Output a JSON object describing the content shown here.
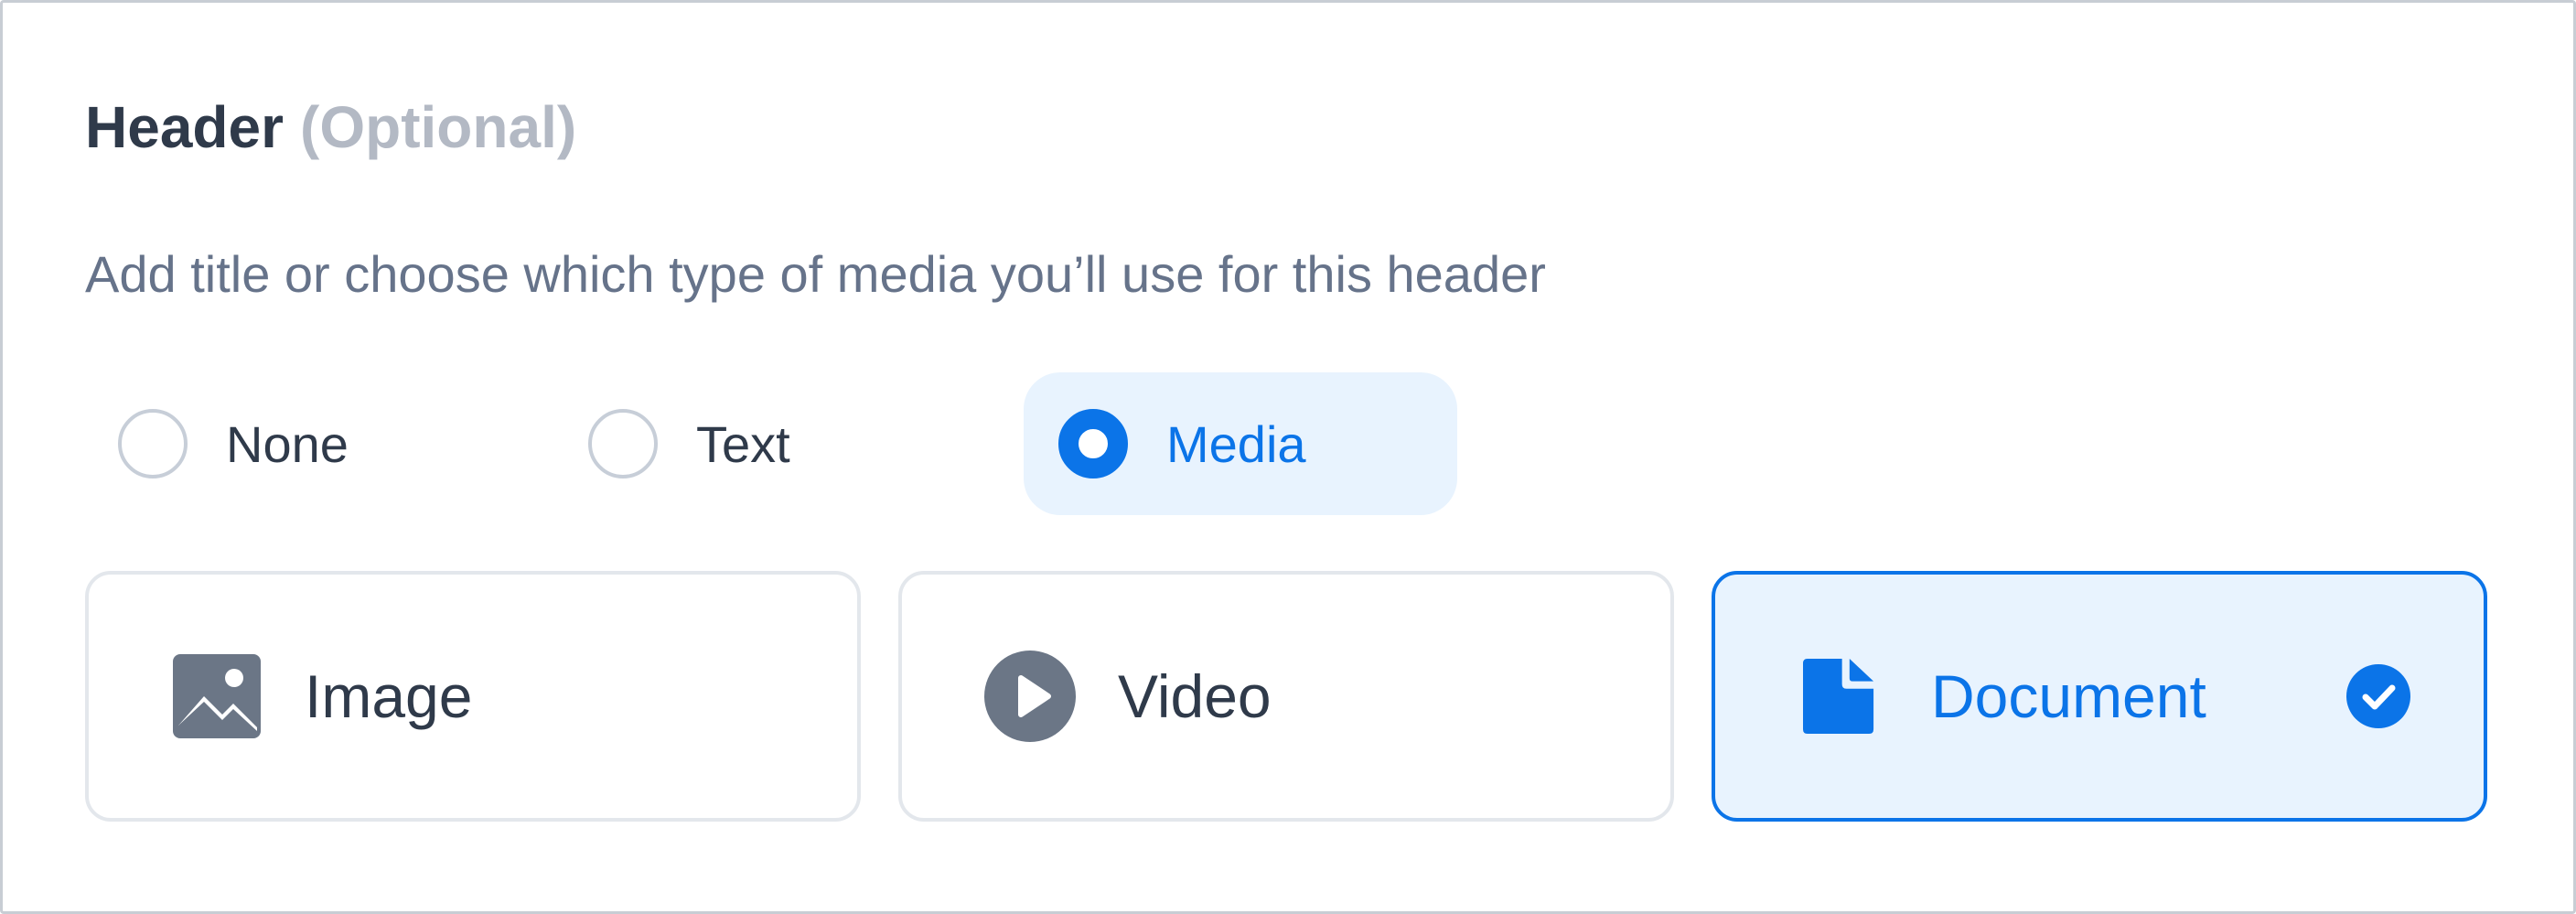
{
  "header": {
    "title": "Header",
    "optional_tag": "(Optional)",
    "subtitle": "Add title or choose which type of media you’ll use for this header"
  },
  "header_type": {
    "options": [
      {
        "label": "None",
        "selected": false
      },
      {
        "label": "Text",
        "selected": false
      },
      {
        "label": "Media",
        "selected": true
      }
    ]
  },
  "media_types": [
    {
      "label": "Image",
      "icon": "image-icon",
      "selected": false
    },
    {
      "label": "Video",
      "icon": "play-circle-icon",
      "selected": false
    },
    {
      "label": "Document",
      "icon": "document-icon",
      "selected": true
    }
  ],
  "colors": {
    "accent": "#0b74e8",
    "accent_bg": "#e8f3fe",
    "text": "#2f3a4a",
    "muted": "#66738a",
    "icon_gray": "#6b7686",
    "border": "#e3e7ec"
  }
}
